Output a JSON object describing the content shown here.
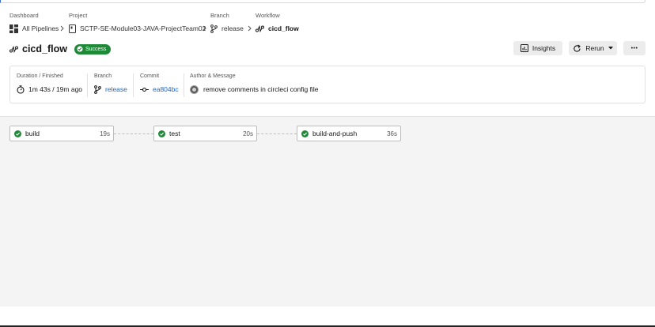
{
  "breadcrumb": {
    "dashboard": {
      "label": "Dashboard",
      "value": "All Pipelines"
    },
    "project": {
      "label": "Project",
      "value": "SCTP-SE-Module03-JAVA-ProjectTeam02"
    },
    "branch": {
      "label": "Branch",
      "value": "release"
    },
    "workflow": {
      "label": "Workflow",
      "value": "cicd_flow"
    },
    "separator": ">"
  },
  "header": {
    "title": "cicd_flow",
    "status": "Success",
    "status_color": "#1e8a37"
  },
  "actions": {
    "insights_label": "Insights",
    "rerun_label": "Rerun",
    "more_label": "•••"
  },
  "info": {
    "duration": {
      "label": "Duration / Finished",
      "value": "1m 43s / 19m ago"
    },
    "branch": {
      "label": "Branch",
      "value": "release"
    },
    "commit": {
      "label": "Commit",
      "value": "ea804bc"
    },
    "author": {
      "label": "Author & Message",
      "value": "remove comments in circleci config file"
    }
  },
  "jobs": [
    {
      "name": "build",
      "duration": "19s"
    },
    {
      "name": "test",
      "duration": "20s"
    },
    {
      "name": "build-and-push",
      "duration": "36s"
    }
  ],
  "icons": {
    "dashboard": "grid-icon",
    "project": "repo-icon",
    "branch": "git-branch-icon",
    "workflow": "workflow-icon",
    "duration": "timer-icon",
    "commit": "git-commit-icon",
    "success": "check-circle-icon"
  },
  "colors": {
    "accent": "#2065c3",
    "success": "#1e8a37",
    "canvas": "#f4f4f4"
  }
}
